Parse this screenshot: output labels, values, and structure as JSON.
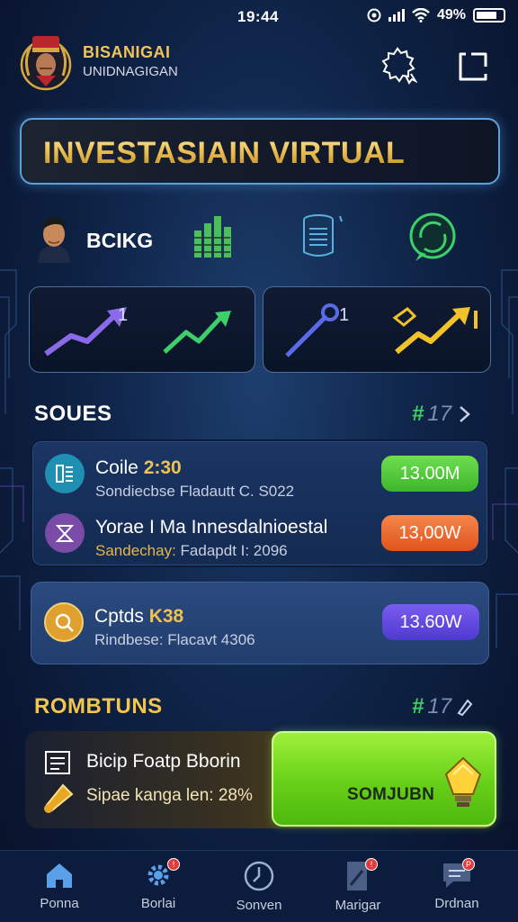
{
  "status_bar": {
    "time": "19:44",
    "battery": "49%",
    "battery_level": 0.49
  },
  "header": {
    "brand_line1": "BISANIGAI",
    "brand_line2": "UNIDNAGIGAN"
  },
  "hero": {
    "title": "INVESTASIAIN VIRTUAL"
  },
  "quick_access": {
    "label": "BCIKG"
  },
  "chart_cards": [
    {
      "badge": "1"
    },
    {
      "badge": "1"
    }
  ],
  "section_scores": {
    "title": "SOUES",
    "count": "17"
  },
  "list_items": [
    {
      "title": "Coile",
      "title_highlight": "2:30",
      "subtitle": "Sondiecbse Fladautt C. S022",
      "amount": "13.00M",
      "amount_color": "#4cc43a",
      "icon": "book-icon",
      "icon_color": "#1f8fb2"
    },
    {
      "title": "Yorae I Ma Innesdalnioestal",
      "title_highlight": "",
      "subtitle_highlight": "Sandechay:",
      "subtitle": "Fadapdt I: 2096",
      "amount": "13,00W",
      "amount_color": "#ee6a2a",
      "icon": "hourglass-icon",
      "icon_color": "#7a4ca8"
    }
  ],
  "single_item": {
    "title": "Cptds",
    "title_highlight": "K38",
    "subtitle": "Rindbese: Flacavt 4306",
    "amount": "13.60W",
    "amount_color": "#6a4ce8",
    "icon": "search-icon",
    "icon_color": "#e0a030"
  },
  "section_rewards": {
    "title": "ROMBTUNS",
    "count": "17"
  },
  "promo": {
    "title": "Bicip Foatp Bborin",
    "subtitle": "Sipae kanga len: 28%",
    "button_label": "SOMJUBN"
  },
  "nav": [
    {
      "label": "Ponna",
      "icon": "home-icon",
      "badge": ""
    },
    {
      "label": "Borlai",
      "icon": "gear-icon",
      "badge": "!"
    },
    {
      "label": "Sonven",
      "icon": "compass-icon",
      "badge": ""
    },
    {
      "label": "Marigar",
      "icon": "document-icon",
      "badge": "!"
    },
    {
      "label": "Drdnan",
      "icon": "chat-icon",
      "badge": "P"
    }
  ]
}
